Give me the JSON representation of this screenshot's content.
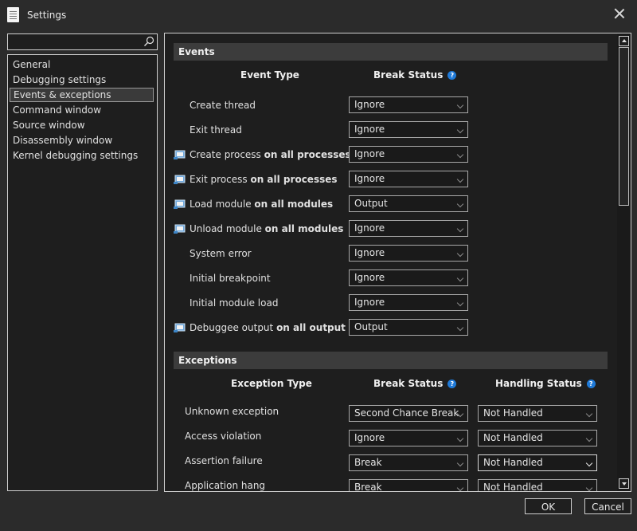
{
  "window": {
    "title": "Settings"
  },
  "search": {
    "placeholder": ""
  },
  "nav": {
    "items": [
      {
        "label": "General"
      },
      {
        "label": "Debugging settings"
      },
      {
        "label": "Events & exceptions",
        "selected": true
      },
      {
        "label": "Command window"
      },
      {
        "label": "Source window"
      },
      {
        "label": "Disassembly window"
      },
      {
        "label": "Kernel debugging settings"
      }
    ]
  },
  "events": {
    "section_title": "Events",
    "col_event_type": "Event Type",
    "col_break_status": "Break Status",
    "help_glyph": "?",
    "rows": [
      {
        "label": "Create thread",
        "scope": "",
        "value": "Ignore",
        "icon": ""
      },
      {
        "label": "Exit thread",
        "scope": "",
        "value": "Ignore",
        "icon": ""
      },
      {
        "label": "Create process ",
        "scope": "on all processes",
        "value": "Ignore",
        "icon": "event-icon"
      },
      {
        "label": "Exit process ",
        "scope": "on all processes",
        "value": "Ignore",
        "icon": "event-icon"
      },
      {
        "label": "Load module ",
        "scope": "on all modules",
        "value": "Output",
        "icon": "event-icon"
      },
      {
        "label": "Unload module ",
        "scope": "on all modules",
        "value": "Ignore",
        "icon": "event-icon"
      },
      {
        "label": "System error",
        "scope": "",
        "value": "Ignore",
        "icon": ""
      },
      {
        "label": "Initial breakpoint",
        "scope": "",
        "value": "Ignore",
        "icon": ""
      },
      {
        "label": "Initial module load",
        "scope": "",
        "value": "Ignore",
        "icon": ""
      },
      {
        "label": "Debuggee output ",
        "scope": "on all output",
        "value": "Output",
        "icon": "event-icon"
      }
    ]
  },
  "exceptions": {
    "section_title": "Exceptions",
    "col_exception_type": "Exception Type",
    "col_break_status": "Break Status",
    "col_handling_status": "Handling Status",
    "rows": [
      {
        "label": "Unknown exception",
        "break": "Second Chance Break",
        "handling": "Not Handled"
      },
      {
        "label": "Access violation",
        "break": "Ignore",
        "handling": "Not Handled"
      },
      {
        "label": "Assertion failure",
        "break": "Break",
        "handling": "Not Handled",
        "focused": true
      },
      {
        "label": "Application hang",
        "break": "Break",
        "handling": "Not Handled"
      }
    ]
  },
  "buttons": {
    "ok": "OK",
    "cancel": "Cancel"
  }
}
